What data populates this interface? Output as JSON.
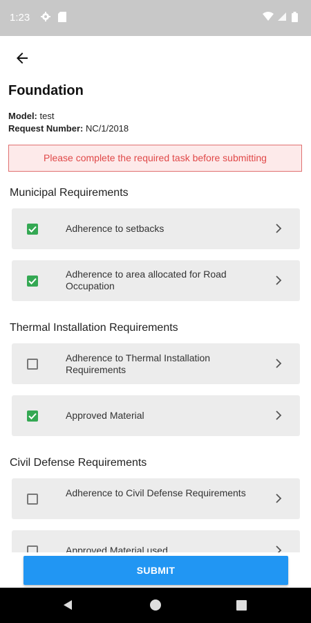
{
  "status_bar": {
    "time": "1:23",
    "bg_color": "#c8c8c8",
    "icons": [
      "gear-icon",
      "sd-card-icon",
      "wifi-icon",
      "signal-icon",
      "battery-icon"
    ]
  },
  "header": {
    "back_icon": "arrow-back-icon",
    "title": "Foundation",
    "model_label": "Model:",
    "model_value": "test",
    "request_label": "Request Number:",
    "request_value": "NC/1/2018"
  },
  "error_banner": {
    "text": "Please complete the required task before submitting",
    "color": "#e04848"
  },
  "sections": [
    {
      "title": "Municipal Requirements",
      "items": [
        {
          "label": "Adherence to setbacks",
          "checked": true
        },
        {
          "label": "Adherence to area allocated for Road Occupation",
          "checked": true
        }
      ]
    },
    {
      "title": "Thermal Installation Requirements",
      "items": [
        {
          "label": "Adherence to Thermal Installation Requirements",
          "checked": false
        },
        {
          "label": "Approved Material",
          "checked": true
        }
      ]
    },
    {
      "title": "Civil Defense Requirements",
      "items": [
        {
          "label": "Adherence to Civil Defense Requirements",
          "checked": false
        },
        {
          "label": "Approved Material used",
          "checked": false
        }
      ]
    }
  ],
  "submit": {
    "label": "SUBMIT",
    "color": "#2196f3"
  },
  "nav_bar": {
    "icons": [
      "nav-back-icon",
      "nav-home-icon",
      "nav-recents-icon"
    ]
  },
  "colors": {
    "check_green": "#34a853",
    "card_bg": "#ececec"
  }
}
